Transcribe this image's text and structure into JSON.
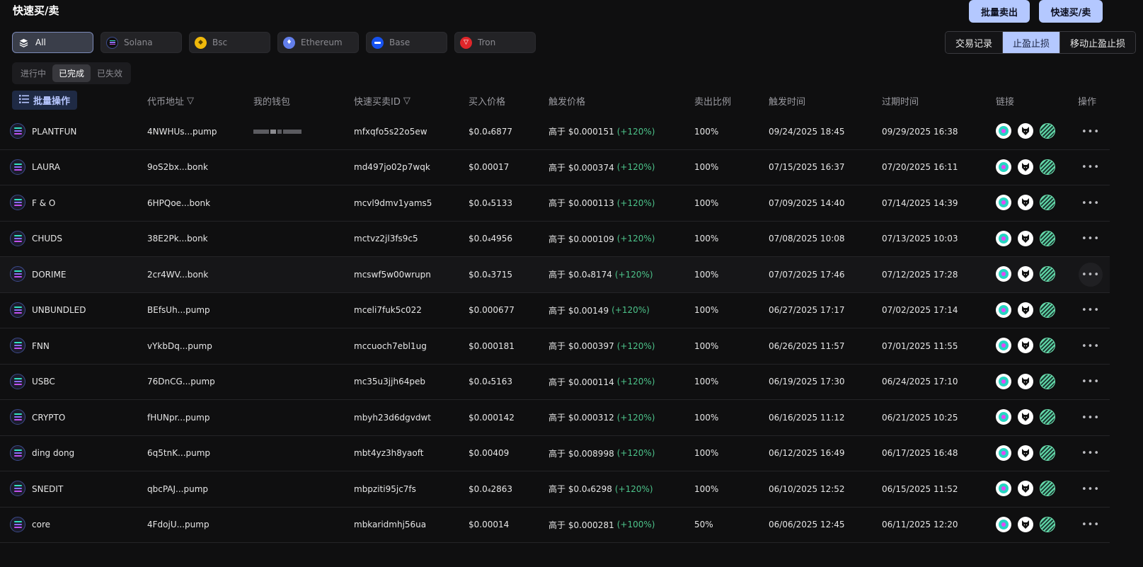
{
  "page_title": "快速买/卖",
  "top_buttons": {
    "batch_sell": "批量卖出",
    "quick_trade": "快速买/卖"
  },
  "chains": [
    {
      "label": "All",
      "icon": "layers-icon",
      "active": true
    },
    {
      "label": "Solana",
      "icon": "solana-icon",
      "active": false
    },
    {
      "label": "Bsc",
      "icon": "bsc-icon",
      "active": false
    },
    {
      "label": "Ethereum",
      "icon": "ethereum-icon",
      "active": false
    },
    {
      "label": "Base",
      "icon": "base-icon",
      "active": false
    },
    {
      "label": "Tron",
      "icon": "tron-icon",
      "active": false
    }
  ],
  "view_tabs": [
    {
      "label": "交易记录",
      "active": false
    },
    {
      "label": "止盈止损",
      "active": true
    },
    {
      "label": "移动止盈止损",
      "active": false
    }
  ],
  "status_tabs": [
    {
      "label": "进行中",
      "active": false
    },
    {
      "label": "已完成",
      "active": true
    },
    {
      "label": "已失效",
      "active": false
    }
  ],
  "batch_ops_label": "批量操作",
  "columns": {
    "address": "代币地址",
    "wallet": "我的钱包",
    "quick_id": "快速买卖ID",
    "buy_price": "买入价格",
    "trigger_price": "触发价格",
    "sell_ratio": "卖出比例",
    "trigger_time": "触发时间",
    "expire_time": "过期时间",
    "links": "链接",
    "actions": "操作"
  },
  "rows": [
    {
      "name": "PLANTFUN",
      "address": "4NWHUs...pump",
      "wallet_masked": true,
      "id": "mfxqfo5s22o5ew",
      "buy_price": "$0.0₄6877",
      "trigger_prefix": "高于 $0.000151",
      "trigger_pct": "(+120%)",
      "ratio": "100%",
      "trigger_time": "09/24/2025 18:45",
      "expire_time": "09/29/2025 16:38"
    },
    {
      "name": "LAURA",
      "address": "9oS2bx...bonk",
      "wallet_masked": false,
      "id": "md497jo02p7wqk",
      "buy_price": "$0.00017",
      "trigger_prefix": "高于 $0.000374",
      "trigger_pct": "(+120%)",
      "ratio": "100%",
      "trigger_time": "07/15/2025 16:37",
      "expire_time": "07/20/2025 16:11"
    },
    {
      "name": "F & O",
      "address": "6HPQoe...bonk",
      "wallet_masked": false,
      "id": "mcvl9dmv1yams5",
      "buy_price": "$0.0₄5133",
      "trigger_prefix": "高于 $0.000113",
      "trigger_pct": "(+120%)",
      "ratio": "100%",
      "trigger_time": "07/09/2025 14:40",
      "expire_time": "07/14/2025 14:39"
    },
    {
      "name": "CHUDS",
      "address": "38E2Pk...bonk",
      "wallet_masked": false,
      "id": "mctvz2jl3fs9c5",
      "buy_price": "$0.0₄4956",
      "trigger_prefix": "高于 $0.000109",
      "trigger_pct": "(+120%)",
      "ratio": "100%",
      "trigger_time": "07/08/2025 10:08",
      "expire_time": "07/13/2025 10:03"
    },
    {
      "name": "DORIME",
      "address": "2cr4WV...bonk",
      "wallet_masked": false,
      "id": "mcswf5w00wrupn",
      "buy_price": "$0.0₄3715",
      "trigger_prefix": "高于 $0.0₄8174",
      "trigger_pct": "(+120%)",
      "ratio": "100%",
      "trigger_time": "07/07/2025 17:46",
      "expire_time": "07/12/2025 17:28"
    },
    {
      "name": "UNBUNDLED",
      "address": "BEfsUh...pump",
      "wallet_masked": false,
      "id": "mceli7fuk5c022",
      "buy_price": "$0.000677",
      "trigger_prefix": "高于 $0.00149",
      "trigger_pct": "(+120%)",
      "ratio": "100%",
      "trigger_time": "06/27/2025 17:17",
      "expire_time": "07/02/2025 17:14"
    },
    {
      "name": "FNN",
      "address": "vYkbDq...pump",
      "wallet_masked": false,
      "id": "mccuoch7ebl1ug",
      "buy_price": "$0.000181",
      "trigger_prefix": "高于 $0.000397",
      "trigger_pct": "(+120%)",
      "ratio": "100%",
      "trigger_time": "06/26/2025 11:57",
      "expire_time": "07/01/2025 11:55"
    },
    {
      "name": "USBC",
      "address": "76DnCG...pump",
      "wallet_masked": false,
      "id": "mc35u3jjh64peb",
      "buy_price": "$0.0₄5163",
      "trigger_prefix": "高于 $0.000114",
      "trigger_pct": "(+120%)",
      "ratio": "100%",
      "trigger_time": "06/19/2025 17:30",
      "expire_time": "06/24/2025 17:10"
    },
    {
      "name": "CRYPTO",
      "address": "fHUNpr...pump",
      "wallet_masked": false,
      "id": "mbyh23d6dgvdwt",
      "buy_price": "$0.000142",
      "trigger_prefix": "高于 $0.000312",
      "trigger_pct": "(+120%)",
      "ratio": "100%",
      "trigger_time": "06/16/2025 11:12",
      "expire_time": "06/21/2025 10:25"
    },
    {
      "name": "ding dong",
      "address": "6q5tnK...pump",
      "wallet_masked": false,
      "id": "mbt4yz3h8yaoft",
      "buy_price": "$0.00409",
      "trigger_prefix": "高于 $0.008998",
      "trigger_pct": "(+120%)",
      "ratio": "100%",
      "trigger_time": "06/12/2025 16:49",
      "expire_time": "06/17/2025 16:48"
    },
    {
      "name": "SNEDIT",
      "address": "qbcPAJ...pump",
      "wallet_masked": false,
      "id": "mbpziti95jc7fs",
      "buy_price": "$0.0₄2863",
      "trigger_prefix": "高于 $0.0₄6298",
      "trigger_pct": "(+120%)",
      "ratio": "100%",
      "trigger_time": "06/10/2025 12:52",
      "expire_time": "06/15/2025 11:52"
    },
    {
      "name": "core",
      "address": "4FdojU...pump",
      "wallet_masked": false,
      "id": "mbkaridmhj56ua",
      "buy_price": "$0.00014",
      "trigger_prefix": "高于 $0.000281",
      "trigger_pct": "(+100%)",
      "ratio": "50%",
      "trigger_time": "06/06/2025 12:45",
      "expire_time": "06/11/2025 12:20"
    }
  ],
  "colors": {
    "accent": "#b4c8ff",
    "positive": "#4cc38a",
    "background": "#0f0f10"
  }
}
